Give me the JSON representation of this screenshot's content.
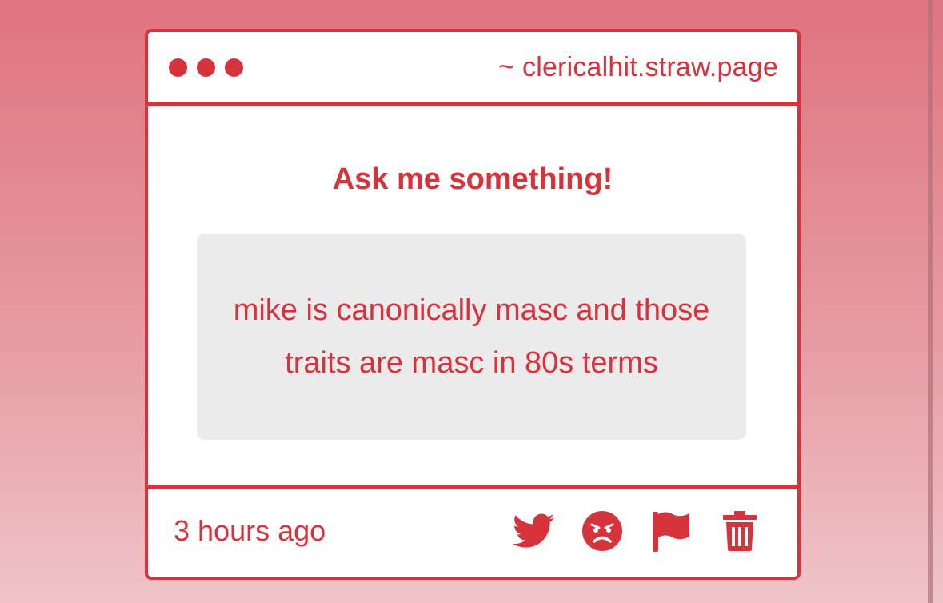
{
  "window": {
    "url": "~ clericalhit.straw.page"
  },
  "main": {
    "heading": "Ask me something!",
    "question": "mike is canonically masc and those traits are masc in 80s terms"
  },
  "footer": {
    "timestamp": "3 hours ago",
    "actions": [
      {
        "name": "twitter-icon"
      },
      {
        "name": "angry-face-icon"
      },
      {
        "name": "flag-icon"
      },
      {
        "name": "trash-icon"
      }
    ]
  },
  "colors": {
    "accent": "#d7333c",
    "question_bg": "#ecebec",
    "card_bg": "#ffffff"
  }
}
